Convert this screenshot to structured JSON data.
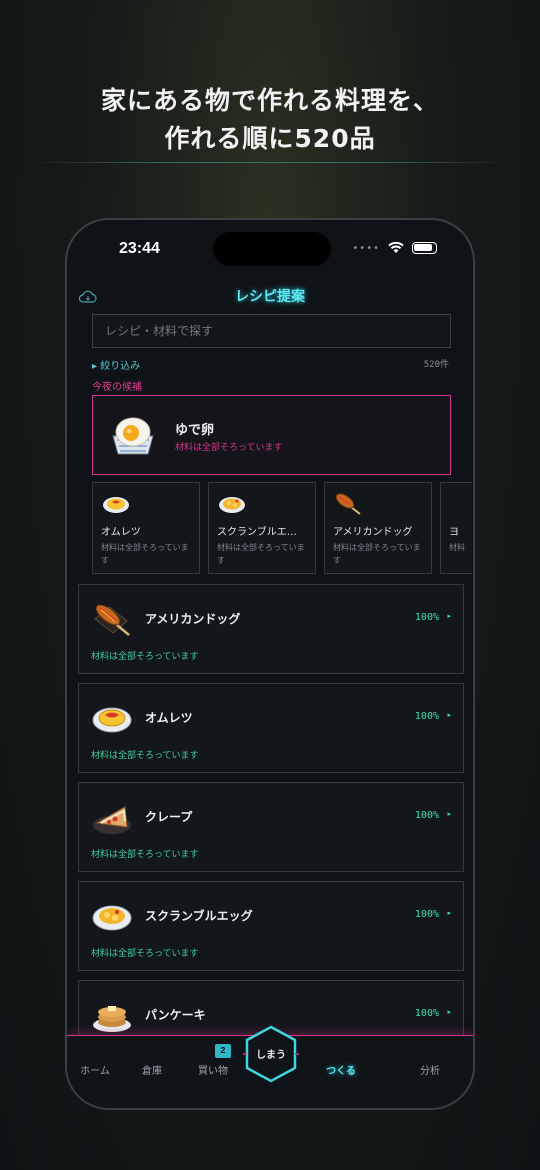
{
  "headline": {
    "line1": "家にある物で作れる料理を、",
    "line2": "作れる順に520品"
  },
  "status_bar": {
    "time": "23:44"
  },
  "header": {
    "title": "レシピ提案",
    "cloud_icon": "cloud-icon"
  },
  "search": {
    "placeholder": "レシピ・材料で探す"
  },
  "filter": {
    "label": "▸ 絞り込み",
    "count": "520件"
  },
  "tonight": {
    "section_label": "今夜の候補",
    "featured": {
      "name": "ゆで卵",
      "status": "材料は全部そろっています",
      "icon": "boiled-egg-icon"
    },
    "candidates": [
      {
        "name": "オムレツ",
        "status": "材料は全部そろっています",
        "icon": "omelette-icon"
      },
      {
        "name": "スクランブルエ…",
        "status": "材料は全部そろっています",
        "icon": "scrambled-egg-icon"
      },
      {
        "name": "アメリカンドッグ",
        "status": "材料は全部そろっています",
        "icon": "corn-dog-icon"
      },
      {
        "name": "ヨ",
        "status": "材料",
        "icon": "partial-card-icon"
      }
    ]
  },
  "recipes": [
    {
      "name": "アメリカンドッグ",
      "percent": "100%",
      "status": "材料は全部そろっています",
      "icon": "corn-dog-icon"
    },
    {
      "name": "オムレツ",
      "percent": "100%",
      "status": "材料は全部そろっています",
      "icon": "omelette-icon"
    },
    {
      "name": "クレープ",
      "percent": "100%",
      "status": "材料は全部そろっています",
      "icon": "crepe-icon"
    },
    {
      "name": "スクランブルエッグ",
      "percent": "100%",
      "status": "材料は全部そろっています",
      "icon": "scrambled-egg-icon"
    },
    {
      "name": "パンケーキ",
      "percent": "100%",
      "status": "",
      "icon": "pancake-icon"
    }
  ],
  "tabbar": {
    "home": "ホーム",
    "storage": "倉庫",
    "shopping": "買い物",
    "shopping_badge": "2",
    "center": "しまう",
    "cook": "つくる",
    "analysis": "分析"
  },
  "colors": {
    "accent_cyan": "#58e4ec",
    "accent_pink": "#d5348a",
    "ok_green": "#3fe0a8"
  }
}
